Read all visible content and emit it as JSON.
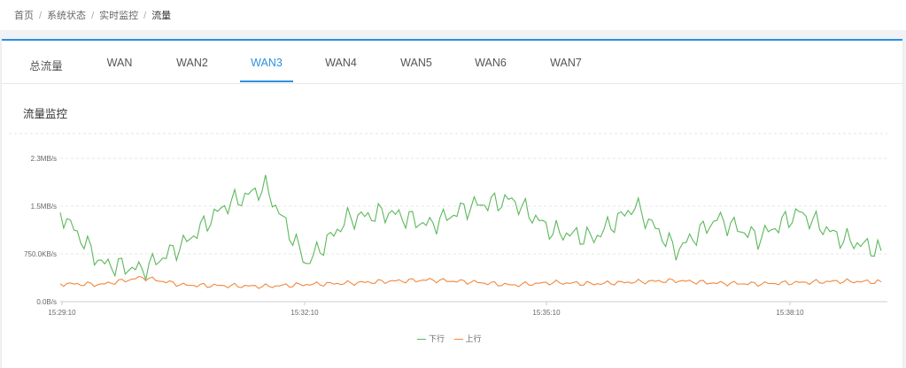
{
  "breadcrumb": [
    "首页",
    "系统状态",
    "实时监控",
    "流量"
  ],
  "tabs": [
    {
      "label": "总流量",
      "active": false
    },
    {
      "label": "WAN",
      "active": false
    },
    {
      "label": "WAN2",
      "active": false
    },
    {
      "label": "WAN3",
      "active": true
    },
    {
      "label": "WAN4",
      "active": false
    },
    {
      "label": "WAN5",
      "active": false
    },
    {
      "label": "WAN6",
      "active": false
    },
    {
      "label": "WAN7",
      "active": false
    }
  ],
  "section_title": "流量监控",
  "colors": {
    "accent": "#2a90e0",
    "download": "#5cb85c",
    "upload": "#f0883e"
  },
  "chart_data": {
    "type": "line",
    "y_tick_labels": [
      "0.0B/s",
      "750.0KB/s",
      "1.5MB/s",
      "2.3MB/s"
    ],
    "x_tick_labels": [
      "15:29:10",
      "15:32:10",
      "15:35:10",
      "15:38:10"
    ],
    "y_unit": "MB/s",
    "ylim": [
      0,
      2.25
    ],
    "x": [
      "15:29:10",
      "15:29:40",
      "15:30:10",
      "15:30:40",
      "15:31:10",
      "15:31:40",
      "15:32:10",
      "15:32:40",
      "15:33:10",
      "15:33:40",
      "15:34:10",
      "15:34:40",
      "15:35:10",
      "15:35:40",
      "15:36:10",
      "15:36:40",
      "15:37:10",
      "15:37:40",
      "15:38:10",
      "15:38:40",
      "15:39:10"
    ],
    "grid": true,
    "legend_position": "bottom",
    "series": [
      {
        "name": "下行",
        "color": "#5cb85c",
        "values": [
          1.4,
          0.6,
          0.5,
          0.9,
          1.5,
          1.8,
          0.6,
          1.3,
          1.4,
          1.2,
          1.5,
          1.6,
          1.1,
          1.0,
          1.5,
          0.8,
          1.3,
          1.0,
          1.4,
          1.0,
          0.8
        ]
      },
      {
        "name": "上行",
        "color": "#f0883e",
        "values": [
          0.28,
          0.27,
          0.38,
          0.26,
          0.25,
          0.24,
          0.27,
          0.29,
          0.32,
          0.34,
          0.31,
          0.26,
          0.3,
          0.28,
          0.31,
          0.33,
          0.29,
          0.28,
          0.3,
          0.32,
          0.31
        ]
      }
    ]
  }
}
